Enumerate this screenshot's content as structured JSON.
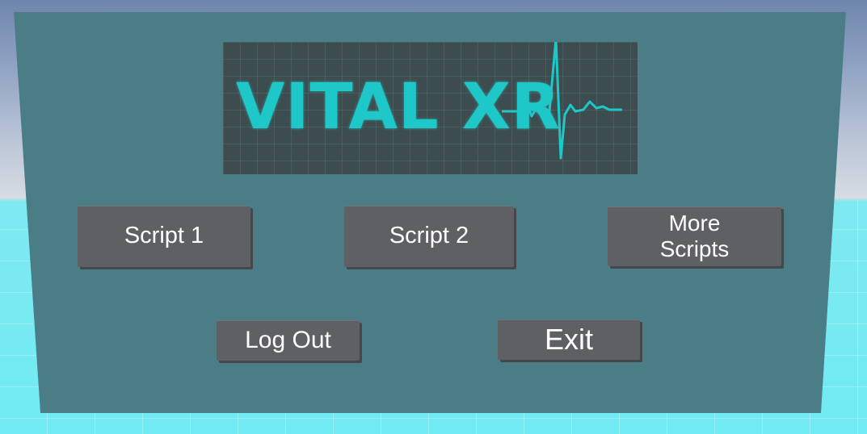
{
  "logo": {
    "text": "VITAL XR",
    "color": "#1fc8c8",
    "icon": "heartbeat-line-icon"
  },
  "buttons": {
    "script1": "Script 1",
    "script2": "Script 2",
    "more_scripts": "More\nScripts",
    "logout": "Log Out",
    "exit": "Exit"
  },
  "colors": {
    "panel": "#4b7d87",
    "button": "#5f6063",
    "floor": "#70eaf3"
  }
}
